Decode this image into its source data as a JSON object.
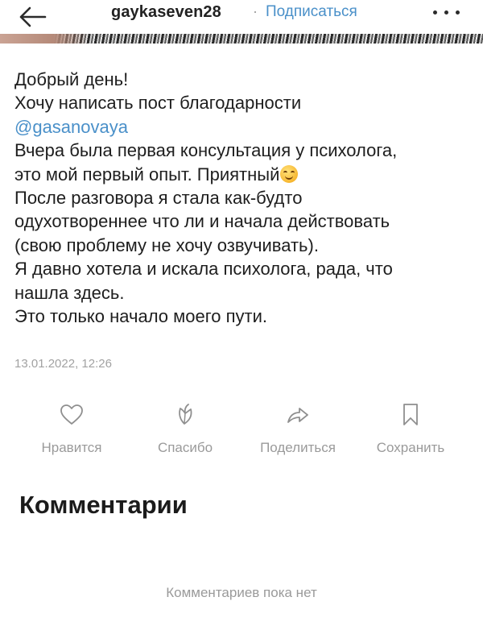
{
  "header": {
    "username": "gaykaseven28",
    "separator": "·",
    "subscribe_label": "Подписаться"
  },
  "post": {
    "lines": [
      "Добрый день!",
      "Хочу написать пост благодарности",
      "@gasanovaya",
      "Вчера была первая консультация у психолога,",
      "это мой первый опыт. Приятный",
      "После разговора я стала как-будто",
      "одухотвореннее что ли и начала действовать",
      "(свою проблему не хочу озвучивать).",
      "Я давно хотела и искала психолога, рада, что",
      "нашла здесь.",
      "Это только начало моего пути."
    ],
    "timestamp": "13.01.2022, 12:26"
  },
  "actions": {
    "like_label": "Нравится",
    "thanks_label": "Спасибо",
    "share_label": "Поделиться",
    "save_label": "Сохранить"
  },
  "comments": {
    "title": "Комментарии",
    "empty_text": "Комментариев пока нет"
  },
  "colors": {
    "accent": "#4a90c9",
    "muted": "#9a9a9a",
    "text": "#1e1e1e"
  },
  "icons": [
    "back-arrow-icon",
    "more-dots-icon",
    "smile-emoji-icon",
    "heart-icon",
    "flower-icon",
    "share-arrow-icon",
    "bookmark-icon"
  ]
}
